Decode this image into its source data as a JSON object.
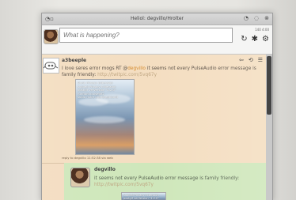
{
  "window": {
    "title": "Heliol: degvillo/Hrolter"
  },
  "composer": {
    "placeholder": "What is happening?",
    "char_count": "140 4:00"
  },
  "tweets": [
    {
      "username": "a3beeple",
      "text_parts": [
        "I love seres error mogs RT @",
        "degvillo",
        " it seems not every PulseAudio error message is family friendly: ",
        "http://twitpic.com/5vq67y"
      ],
      "preview_text": "Dunk Privacy Extension\nsuplied Privacy Extension\npostgif verVersion \"4.2.0\"\nrunflunt pulsegif2\nsuplo mare org.foreground",
      "meta": "reply to degvillo 11:52:38 via web"
    },
    {
      "username": "degvillo",
      "text_parts": [
        "it seems not every PulseAudio error message is family friendly: ",
        "http://twitpic.com/5vq67y"
      ],
      "preview_text": "suplied Privacy Extension\npostgif verVersion \"4.2.0\""
    }
  ],
  "icons": {
    "window_left": "chat-icon",
    "minimize": "minimize-icon",
    "restore": "restore-icon",
    "close": "close-icon",
    "refresh": "refresh-icon",
    "settings": "settings-icon",
    "gear": "gear-icon",
    "reply": "reply-icon",
    "retweet": "retweet-icon",
    "menu": "menu-icon"
  }
}
